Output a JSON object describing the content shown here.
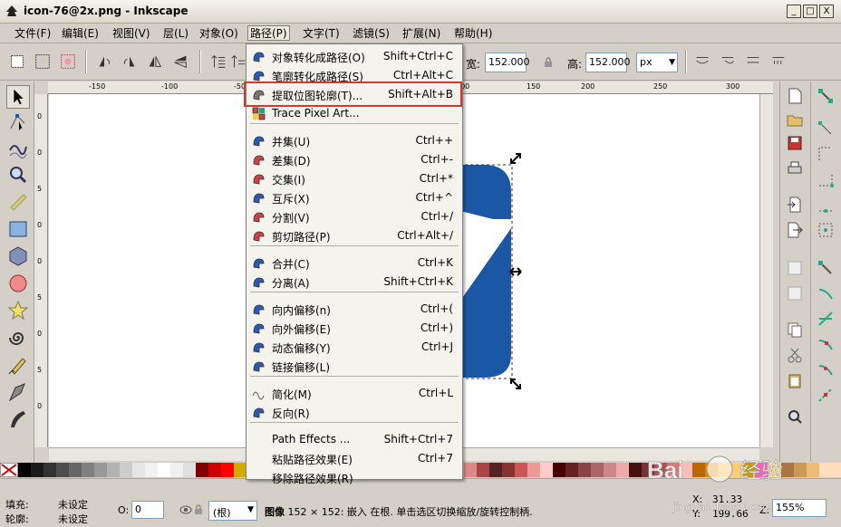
{
  "window": {
    "title": "icon-76@2x.png - Inkscape",
    "buttons": [
      "_",
      "□",
      "X"
    ]
  },
  "menubar": [
    "文件(F)",
    "编辑(E)",
    "视图(V)",
    "层(L)",
    "对象(O)",
    "路径(P)",
    "文字(T)",
    "滤镜(S)",
    "扩展(N)",
    "帮助(H)"
  ],
  "toolbar": {
    "width_label": "宽:",
    "width_value": "152.000",
    "height_label": "高:",
    "height_value": "152.000",
    "unit": "px"
  },
  "ruler": {
    "top_ticks": [
      "-150",
      "-100",
      "-50",
      "0",
      "50",
      "100",
      "150",
      "200",
      "250",
      "300"
    ],
    "left_ticks": [
      "0",
      "0",
      "5",
      "0",
      "0",
      "5",
      "0",
      "5",
      "0"
    ]
  },
  "path_menu": [
    {
      "label": "对象转化成路径(O)",
      "shortcut": "Shift+Ctrl+C",
      "icon": "object-to-path-icon"
    },
    {
      "label": "笔廓转化成路径(S)",
      "shortcut": "Ctrl+Alt+C",
      "icon": "stroke-to-path-icon"
    },
    {
      "label": "提取位图轮廓(T)...",
      "shortcut": "Shift+Alt+B",
      "icon": "trace-bitmap-icon",
      "highlighted": true
    },
    {
      "label": "Trace Pixel Art...",
      "shortcut": "",
      "icon": "trace-pixel-art-icon"
    },
    {
      "label": "并集(U)",
      "shortcut": "Ctrl++",
      "icon": "union-icon"
    },
    {
      "label": "差集(D)",
      "shortcut": "Ctrl+-",
      "icon": "difference-icon"
    },
    {
      "label": "交集(I)",
      "shortcut": "Ctrl+*",
      "icon": "intersection-icon"
    },
    {
      "label": "互斥(X)",
      "shortcut": "Ctrl+^",
      "icon": "exclusion-icon"
    },
    {
      "label": "分割(V)",
      "shortcut": "Ctrl+/",
      "icon": "division-icon"
    },
    {
      "label": "剪切路径(P)",
      "shortcut": "Ctrl+Alt+/",
      "icon": "cut-path-icon"
    },
    {
      "label": "合并(C)",
      "shortcut": "Ctrl+K",
      "icon": "combine-icon"
    },
    {
      "label": "分离(A)",
      "shortcut": "Shift+Ctrl+K",
      "icon": "break-apart-icon"
    },
    {
      "label": "向内偏移(n)",
      "shortcut": "Ctrl+(",
      "icon": "inset-icon"
    },
    {
      "label": "向外偏移(E)",
      "shortcut": "Ctrl+)",
      "icon": "outset-icon"
    },
    {
      "label": "动态偏移(Y)",
      "shortcut": "Ctrl+J",
      "icon": "dynamic-offset-icon"
    },
    {
      "label": "链接偏移(L)",
      "shortcut": "",
      "icon": "linked-offset-icon"
    },
    {
      "label": "简化(M)",
      "shortcut": "Ctrl+L",
      "icon": "simplify-icon"
    },
    {
      "label": "反向(R)",
      "shortcut": "",
      "icon": "reverse-icon"
    },
    {
      "label": "Path Effects ...",
      "shortcut": "Shift+Ctrl+7",
      "icon": ""
    },
    {
      "label": "粘贴路径效果(E)",
      "shortcut": "Ctrl+7",
      "icon": ""
    },
    {
      "label": "移除路径效果(R)",
      "shortcut": "",
      "icon": ""
    }
  ],
  "status": {
    "fill_label": "填充:",
    "fill_value": "未设定",
    "stroke_label": "轮廓:",
    "stroke_value": "未设定",
    "opacity_label": "O:",
    "opacity_value": "0",
    "layer_value": "(根)",
    "message_bold": "图像",
    "message": " 152 × 152: 嵌入 在根. 单击选区切换缩放/旋转控制柄.",
    "x_label": "X:",
    "x_value": "31.33",
    "y_label": "Y:",
    "y_value": "199.66",
    "z_label": "Z:",
    "zoom_value": "155%"
  },
  "watermark": {
    "text": "Bai 经验",
    "url": "jingyan.baidu.com"
  },
  "colors": {
    "accent_blue": "#1c57a6",
    "highlight_red": "#e0342a",
    "chrome": "#d4d0c8"
  }
}
